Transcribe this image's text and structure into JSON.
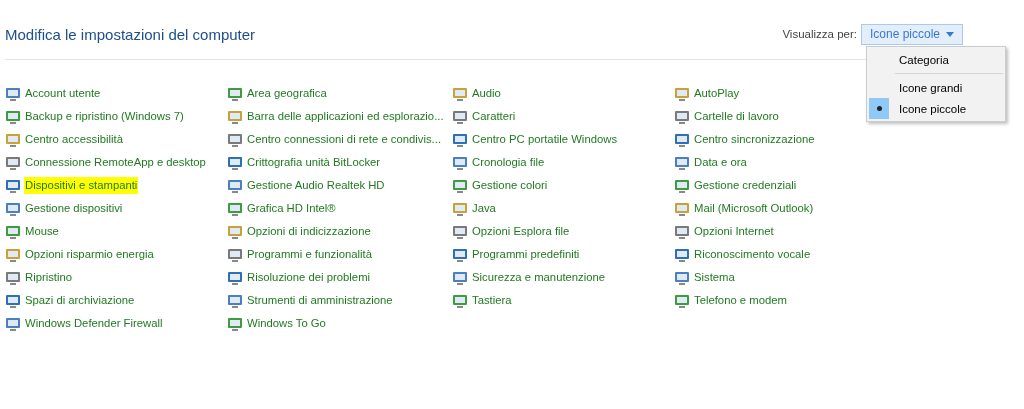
{
  "title": "Modifica le impostazioni del computer",
  "view_by": {
    "label": "Visualizza per:",
    "value": "Icone piccole",
    "expanded": true
  },
  "view_menu": {
    "groups": [
      [
        {
          "label": "Categoria",
          "selected": false
        }
      ],
      [
        {
          "label": "Icone grandi",
          "selected": false
        },
        {
          "label": "Icone piccole",
          "selected": true
        }
      ]
    ]
  },
  "columns": [
    [
      {
        "label": "Account utente",
        "highlighted": false
      },
      {
        "label": "Backup e ripristino (Windows 7)",
        "highlighted": false
      },
      {
        "label": "Centro accessibilità",
        "highlighted": false
      },
      {
        "label": "Connessione RemoteApp e desktop",
        "highlighted": false
      },
      {
        "label": "Dispositivi e stampanti",
        "highlighted": true
      },
      {
        "label": "Gestione dispositivi",
        "highlighted": false
      },
      {
        "label": "Mouse",
        "highlighted": false
      },
      {
        "label": "Opzioni risparmio energia",
        "highlighted": false
      },
      {
        "label": "Ripristino",
        "highlighted": false
      },
      {
        "label": "Spazi di archiviazione",
        "highlighted": false
      },
      {
        "label": "Windows Defender Firewall",
        "highlighted": false
      }
    ],
    [
      {
        "label": "Area geografica",
        "highlighted": false
      },
      {
        "label": "Barra delle applicazioni ed esplorazio...",
        "highlighted": false
      },
      {
        "label": "Centro connessioni di rete e condivis...",
        "highlighted": false
      },
      {
        "label": "Crittografia unità BitLocker",
        "highlighted": false
      },
      {
        "label": "Gestione Audio Realtek HD",
        "highlighted": false
      },
      {
        "label": "Grafica HD Intel®",
        "highlighted": false
      },
      {
        "label": "Opzioni di indicizzazione",
        "highlighted": false
      },
      {
        "label": "Programmi e funzionalità",
        "highlighted": false
      },
      {
        "label": "Risoluzione dei problemi",
        "highlighted": false
      },
      {
        "label": "Strumenti di amministrazione",
        "highlighted": false
      },
      {
        "label": "Windows To Go",
        "highlighted": false
      }
    ],
    [
      {
        "label": "Audio",
        "highlighted": false
      },
      {
        "label": "Caratteri",
        "highlighted": false
      },
      {
        "label": "Centro PC portatile Windows",
        "highlighted": false
      },
      {
        "label": "Cronologia file",
        "highlighted": false
      },
      {
        "label": "Gestione colori",
        "highlighted": false
      },
      {
        "label": "Java",
        "highlighted": false
      },
      {
        "label": "Opzioni Esplora file",
        "highlighted": false
      },
      {
        "label": "Programmi predefiniti",
        "highlighted": false
      },
      {
        "label": "Sicurezza e manutenzione",
        "highlighted": false
      },
      {
        "label": "Tastiera",
        "highlighted": false
      }
    ],
    [
      {
        "label": "AutoPlay",
        "highlighted": false
      },
      {
        "label": "Cartelle di lavoro",
        "highlighted": false
      },
      {
        "label": "Centro sincronizzazione",
        "highlighted": false
      },
      {
        "label": "Data e ora",
        "highlighted": false
      },
      {
        "label": "Gestione credenziali",
        "highlighted": false
      },
      {
        "label": "Mail (Microsoft Outlook)",
        "highlighted": false
      },
      {
        "label": "Opzioni Internet",
        "highlighted": false
      },
      {
        "label": "Riconoscimento vocale",
        "highlighted": false
      },
      {
        "label": "Sistema",
        "highlighted": false
      },
      {
        "label": "Telefono e modem",
        "highlighted": false
      }
    ]
  ]
}
